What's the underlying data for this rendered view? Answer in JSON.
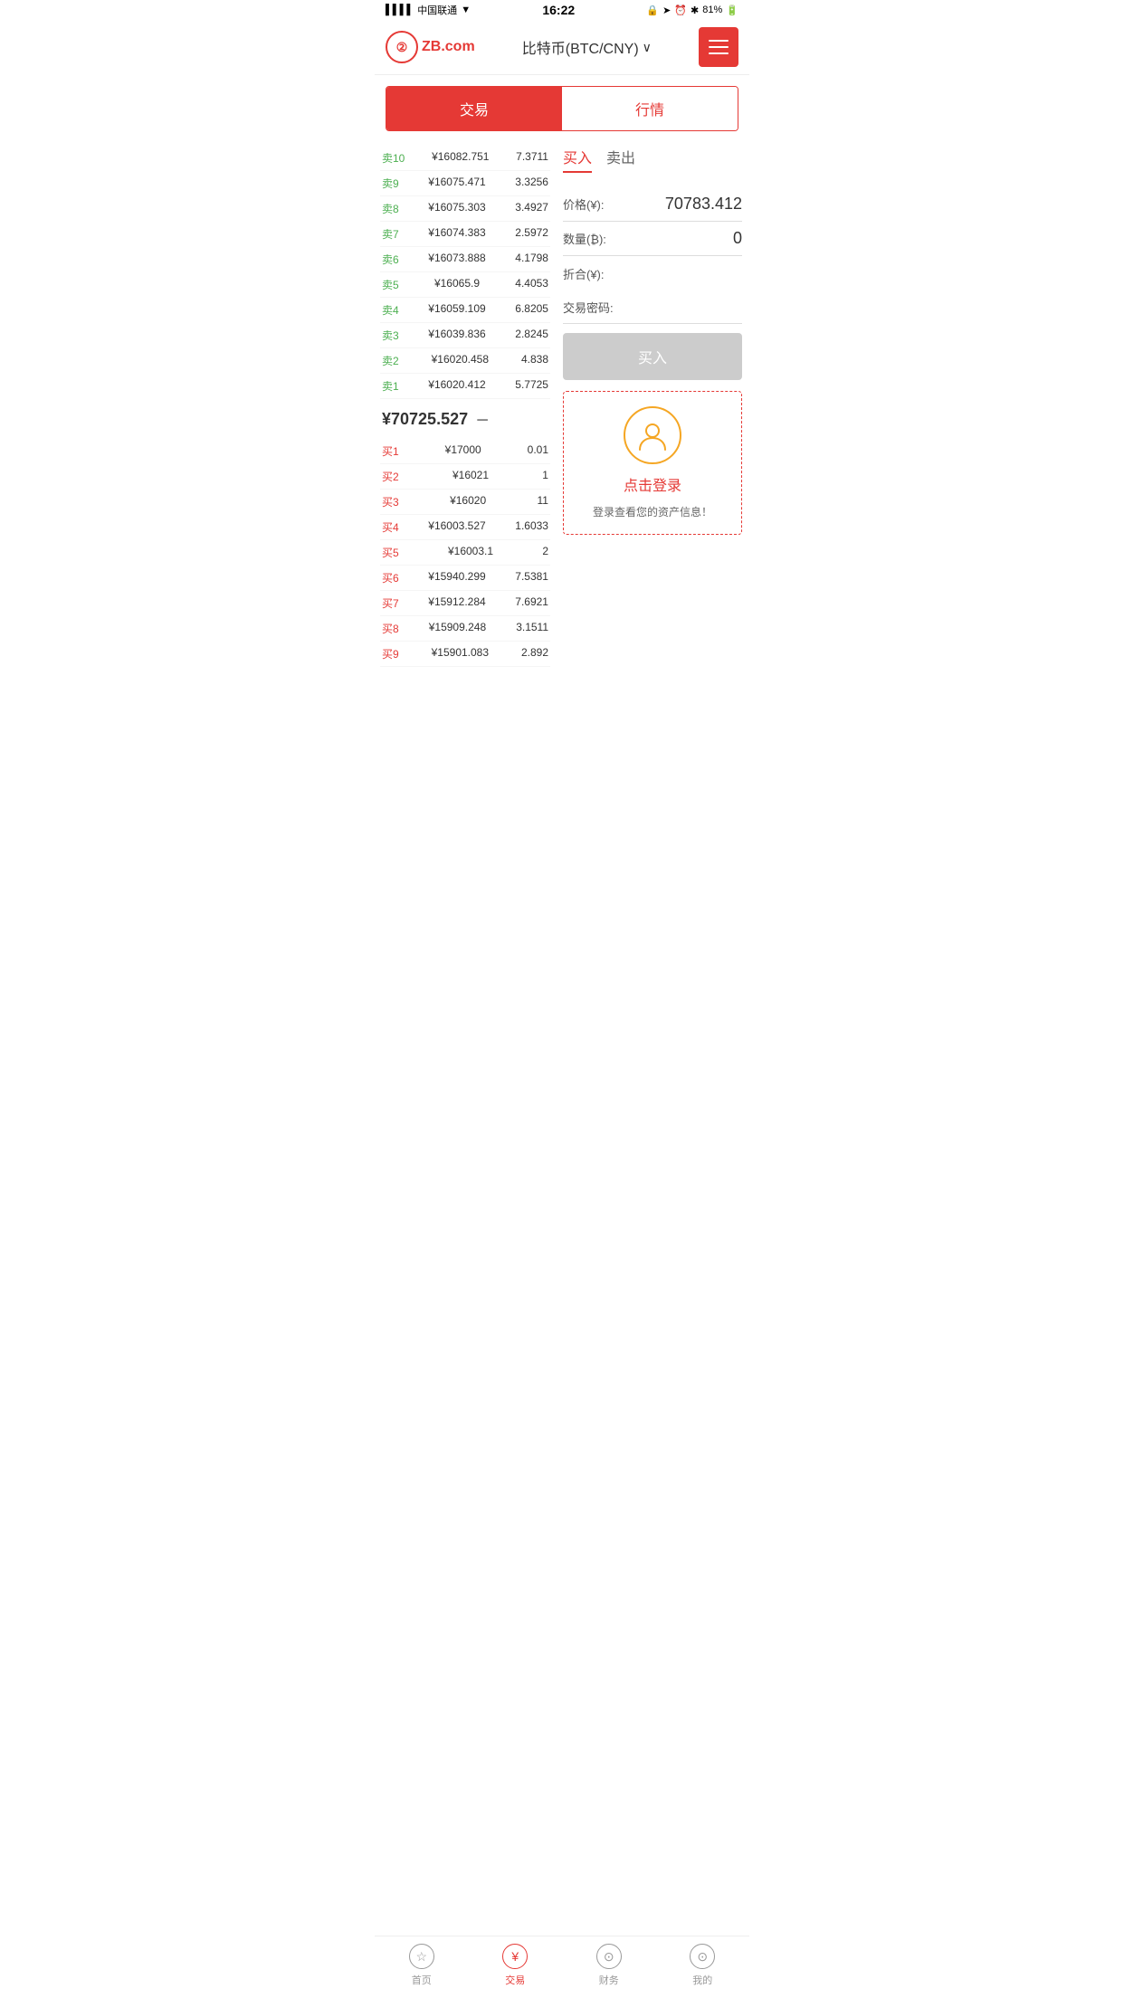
{
  "statusBar": {
    "carrier": "中国联通",
    "time": "16:22",
    "battery": "81%"
  },
  "header": {
    "logoText": "ZB.com",
    "title": "比特币(BTC/CNY)",
    "menuLabel": "menu"
  },
  "tabs": {
    "tab1": "交易",
    "tab2": "行情",
    "activeTab": "tab1"
  },
  "buySell": {
    "buyLabel": "买入",
    "sellLabel": "卖出",
    "active": "buy"
  },
  "tradePanel": {
    "priceLabel": "价格(¥):",
    "priceValue": "70783.412",
    "qtyLabel": "数量(₿):",
    "qtyValue": "0",
    "zheheLabel": "折合(¥):",
    "zheheValue": "",
    "passwordLabel": "交易密码:",
    "passwordValue": "",
    "buyBtnLabel": "买入"
  },
  "orderBook": {
    "sellOrders": [
      {
        "label": "卖10",
        "price": "¥16082.751",
        "qty": "7.3711"
      },
      {
        "label": "卖9",
        "price": "¥16075.471",
        "qty": "3.3256"
      },
      {
        "label": "卖8",
        "price": "¥16075.303",
        "qty": "3.4927"
      },
      {
        "label": "卖7",
        "price": "¥16074.383",
        "qty": "2.5972"
      },
      {
        "label": "卖6",
        "price": "¥16073.888",
        "qty": "4.1798"
      },
      {
        "label": "卖5",
        "price": "¥16065.9",
        "qty": "4.4053"
      },
      {
        "label": "卖4",
        "price": "¥16059.109",
        "qty": "6.8205"
      },
      {
        "label": "卖3",
        "price": "¥16039.836",
        "qty": "2.8245"
      },
      {
        "label": "卖2",
        "price": "¥16020.458",
        "qty": "4.838"
      },
      {
        "label": "卖1",
        "price": "¥16020.412",
        "qty": "5.7725"
      }
    ],
    "currentPrice": "¥70725.527",
    "priceIndicator": "－",
    "buyOrders": [
      {
        "label": "买1",
        "price": "¥17000",
        "qty": "0.01"
      },
      {
        "label": "买2",
        "price": "¥16021",
        "qty": "1"
      },
      {
        "label": "买3",
        "price": "¥16020",
        "qty": "11"
      },
      {
        "label": "买4",
        "price": "¥16003.527",
        "qty": "1.6033"
      },
      {
        "label": "买5",
        "price": "¥16003.1",
        "qty": "2"
      },
      {
        "label": "买6",
        "price": "¥15940.299",
        "qty": "7.5381"
      },
      {
        "label": "买7",
        "price": "¥15912.284",
        "qty": "7.6921"
      },
      {
        "label": "买8",
        "price": "¥15909.248",
        "qty": "3.1511"
      },
      {
        "label": "买9",
        "price": "¥15901.083",
        "qty": "2.892"
      }
    ]
  },
  "loginPrompt": {
    "loginText": "点击登录",
    "subText": "登录查看您的资产信息！"
  },
  "bottomNav": [
    {
      "label": "首页",
      "icon": "★",
      "active": false
    },
    {
      "label": "交易",
      "icon": "¥",
      "active": true
    },
    {
      "label": "财务",
      "icon": "💰",
      "active": false
    },
    {
      "label": "我的",
      "icon": "👤",
      "active": false
    }
  ]
}
